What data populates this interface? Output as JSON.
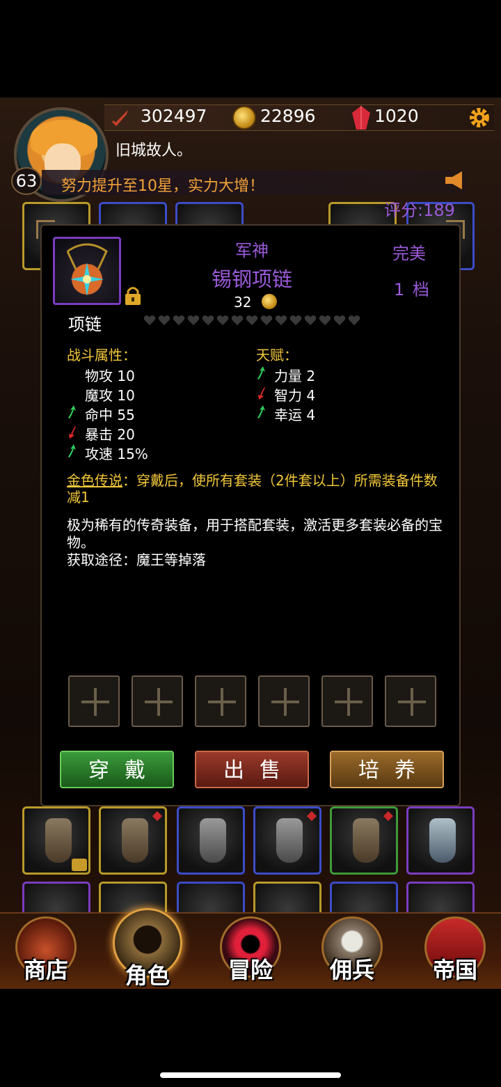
{
  "header": {
    "power": "302497",
    "gold": "22896",
    "gems": "1020",
    "level": "63",
    "chat_message": "旧城故人。",
    "banner_text": "努力提升至10星，实力大增！",
    "score": "评分:189"
  },
  "item": {
    "prefix": "军神",
    "name": "锡钢项链",
    "price": "32",
    "quality": "完美",
    "grade": "1 档",
    "type": "项链",
    "star_slots": 15,
    "combat_title": "战斗属性：",
    "combat_stats": [
      {
        "label": "物攻 10",
        "trend": "none"
      },
      {
        "label": "魔攻 10",
        "trend": "none"
      },
      {
        "label": "命中 55",
        "trend": "up"
      },
      {
        "label": "暴击 20",
        "trend": "down"
      },
      {
        "label": "攻速 15%",
        "trend": "up"
      }
    ],
    "talent_title": "天赋：",
    "talents": [
      {
        "label": "力量 2",
        "trend": "up"
      },
      {
        "label": "智力 4",
        "trend": "down"
      },
      {
        "label": "幸运 4",
        "trend": "up"
      }
    ],
    "legend_key": "金色传说",
    "legend_text": "：穿戴后，使所有套装（2件套以上）所需装备件数减1",
    "description": "极为稀有的传奇装备，用于搭配套装，激活更多套装必备的宝物。",
    "source": "获取途径：魔王等掉落",
    "socket_count": 6
  },
  "actions": {
    "equip": "穿戴",
    "sell": "出售",
    "train": "培养"
  },
  "nav": {
    "shop": "商店",
    "character": "角色",
    "adventure": "冒险",
    "mercenary": "佣兵",
    "empire": "帝国"
  },
  "colors": {
    "epic_purple": "#9a5ad8",
    "legend_gold": "#f2c83a",
    "banner_orange": "#f2a23a",
    "up_arrow": "#2ecc5a",
    "down_arrow": "#e0282a"
  }
}
